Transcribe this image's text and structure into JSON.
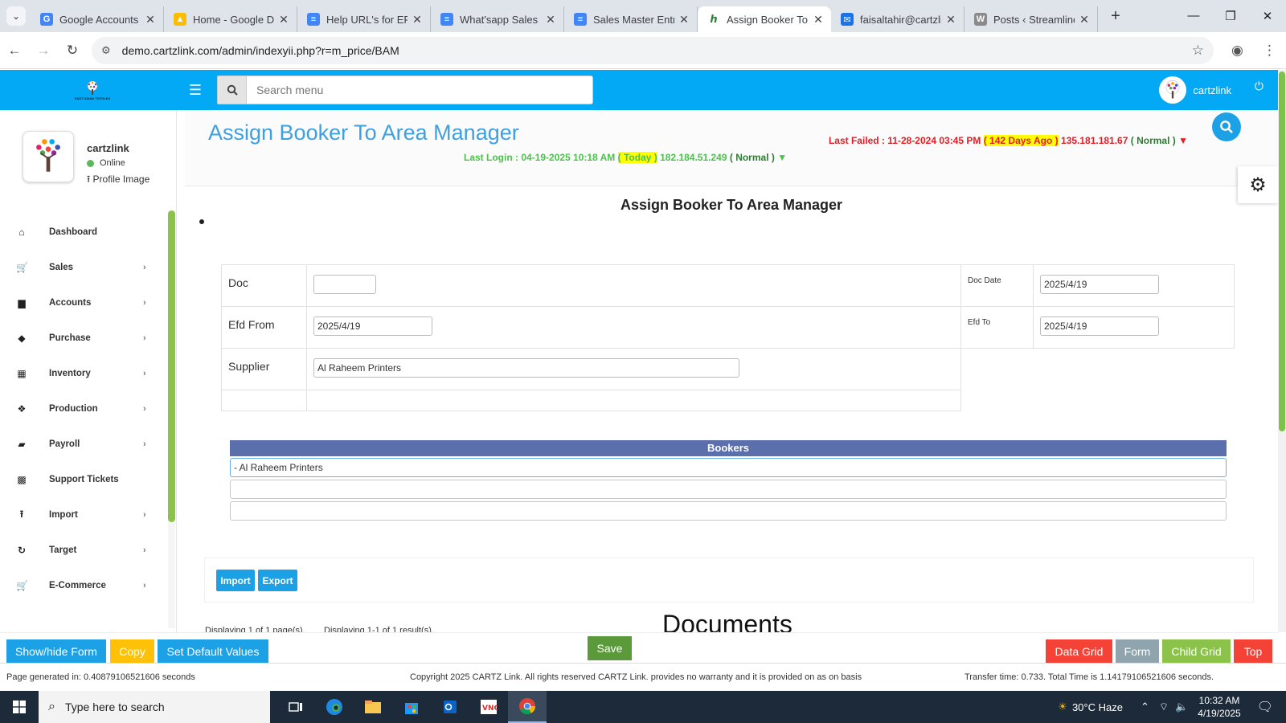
{
  "browser": {
    "tabs": [
      {
        "label": "Google Accounts",
        "icon": "google-icon",
        "color": "#4285f4"
      },
      {
        "label": "Home - Google Dr",
        "icon": "drive-icon",
        "color": "#fbbc04"
      },
      {
        "label": "Help URL's for ERP",
        "icon": "docs-icon",
        "color": "#4285f4"
      },
      {
        "label": "What'sapp Sales M",
        "icon": "docs-icon",
        "color": "#4285f4"
      },
      {
        "label": "Sales Master Entry",
        "icon": "docs-icon",
        "color": "#4285f4"
      },
      {
        "label": "Assign Booker To",
        "icon": "cartzlink-icon",
        "color": "#4caf50",
        "active": true
      },
      {
        "label": "faisaltahir@cartzli",
        "icon": "mail-icon",
        "color": "#1a73e8"
      },
      {
        "label": "Posts ‹ Streamline",
        "icon": "wordpress-icon",
        "color": "#8a8a8a"
      }
    ],
    "url": "demo.cartzlink.com/admin/indexyii.php?r=m_price/BAM"
  },
  "header": {
    "search_placeholder": "Search menu",
    "user_name": "cartzlink",
    "logo_caption": "EAST ASIAN TEXTILES"
  },
  "sidebar": {
    "profile_name": "cartzlink",
    "status": "Online",
    "profile_image_label": "Profile Image",
    "items": [
      {
        "label": "Dashboard",
        "icon": "home-icon",
        "glyph": "⌂",
        "chevron": false
      },
      {
        "label": "Sales",
        "icon": "cart-icon",
        "glyph": "🛒",
        "chevron": true
      },
      {
        "label": "Accounts",
        "icon": "briefcase-icon",
        "glyph": "▆",
        "chevron": true
      },
      {
        "label": "Purchase",
        "icon": "tags-icon",
        "glyph": "◆",
        "chevron": true
      },
      {
        "label": "Inventory",
        "icon": "grid-icon",
        "glyph": "▦",
        "chevron": true
      },
      {
        "label": "Production",
        "icon": "cubes-icon",
        "glyph": "❖",
        "chevron": true
      },
      {
        "label": "Payroll",
        "icon": "money-icon",
        "glyph": "▰",
        "chevron": true
      },
      {
        "label": "Support Tickets",
        "icon": "ticket-icon",
        "glyph": "▩",
        "chevron": false
      },
      {
        "label": "Import",
        "icon": "upload-icon",
        "glyph": "⭱",
        "chevron": true
      },
      {
        "label": "Target",
        "icon": "refresh-icon",
        "glyph": "↻",
        "chevron": true
      },
      {
        "label": "E-Commerce",
        "icon": "cart-icon",
        "glyph": "🛒",
        "chevron": true
      }
    ]
  },
  "page": {
    "title": "Assign Booker To Area Manager",
    "last_login_prefix": "Last Login : 04-19-2025 10:18 AM",
    "last_login_highlight": "( Today )",
    "last_login_ip": "182.184.51.249",
    "last_login_status": "( Normal )",
    "last_login_arrow": "▼",
    "last_failed_prefix": "Last Failed : 11-28-2024 03:45 PM",
    "last_failed_highlight": "( 142 Days Ago )",
    "last_failed_ip": "135.181.181.67",
    "last_failed_status": "( Normal )",
    "last_failed_arrow": "▼",
    "form_heading": "Assign Booker To Area Manager"
  },
  "form": {
    "doc_label": "Doc",
    "doc_value": "",
    "doc_date_label": "Doc Date",
    "doc_date_value": "2025/4/19",
    "efd_from_label": "Efd From",
    "efd_from_value": "2025/4/19",
    "efd_to_label": "Efd To",
    "efd_to_value": "2025/4/19",
    "supplier_label": "Supplier",
    "supplier_value": "Al Raheem Printers"
  },
  "bookers": {
    "heading": "Bookers",
    "rows": [
      "- Al Raheem Printers",
      "",
      ""
    ]
  },
  "actions": {
    "import_label": "Import",
    "export_label": "Export",
    "display_pages": "Displaying 1 of 1 page(s).",
    "display_results": "Displaying 1-1 of 1 result(s).",
    "documents_heading": "Documents"
  },
  "toolbar": {
    "show_hide": "Show/hide Form",
    "copy": "Copy",
    "set_default": "Set Default Values",
    "save": "Save",
    "data_grid": "Data Grid",
    "form": "Form",
    "child_grid": "Child Grid",
    "top": "Top"
  },
  "footer": {
    "generated": "Page generated in: 0.40879106521606 seconds",
    "copyright": "Copyright 2025 CARTZ Link. All rights reserved CARTZ Link. provides no warranty and it is provided on as on basis",
    "transfer": "Transfer time: 0.733. Total Time is 1.14179106521606 seconds."
  },
  "taskbar": {
    "search_placeholder": "Type here to search",
    "weather": "30°C  Haze",
    "time": "10:32 AM",
    "date": "4/19/2025"
  },
  "colors": {
    "header": "#03a9f4",
    "title": "#3ea0de",
    "login_green": "#4cc24c",
    "failed_red": "#e51c23",
    "bookers_head": "#5b6fad",
    "save_green": "#5cb85c",
    "copy_orange": "#ffc107",
    "datagrid_red": "#f44336",
    "form_grey": "#90a4ae",
    "childgrid_green": "#8bc34a"
  }
}
